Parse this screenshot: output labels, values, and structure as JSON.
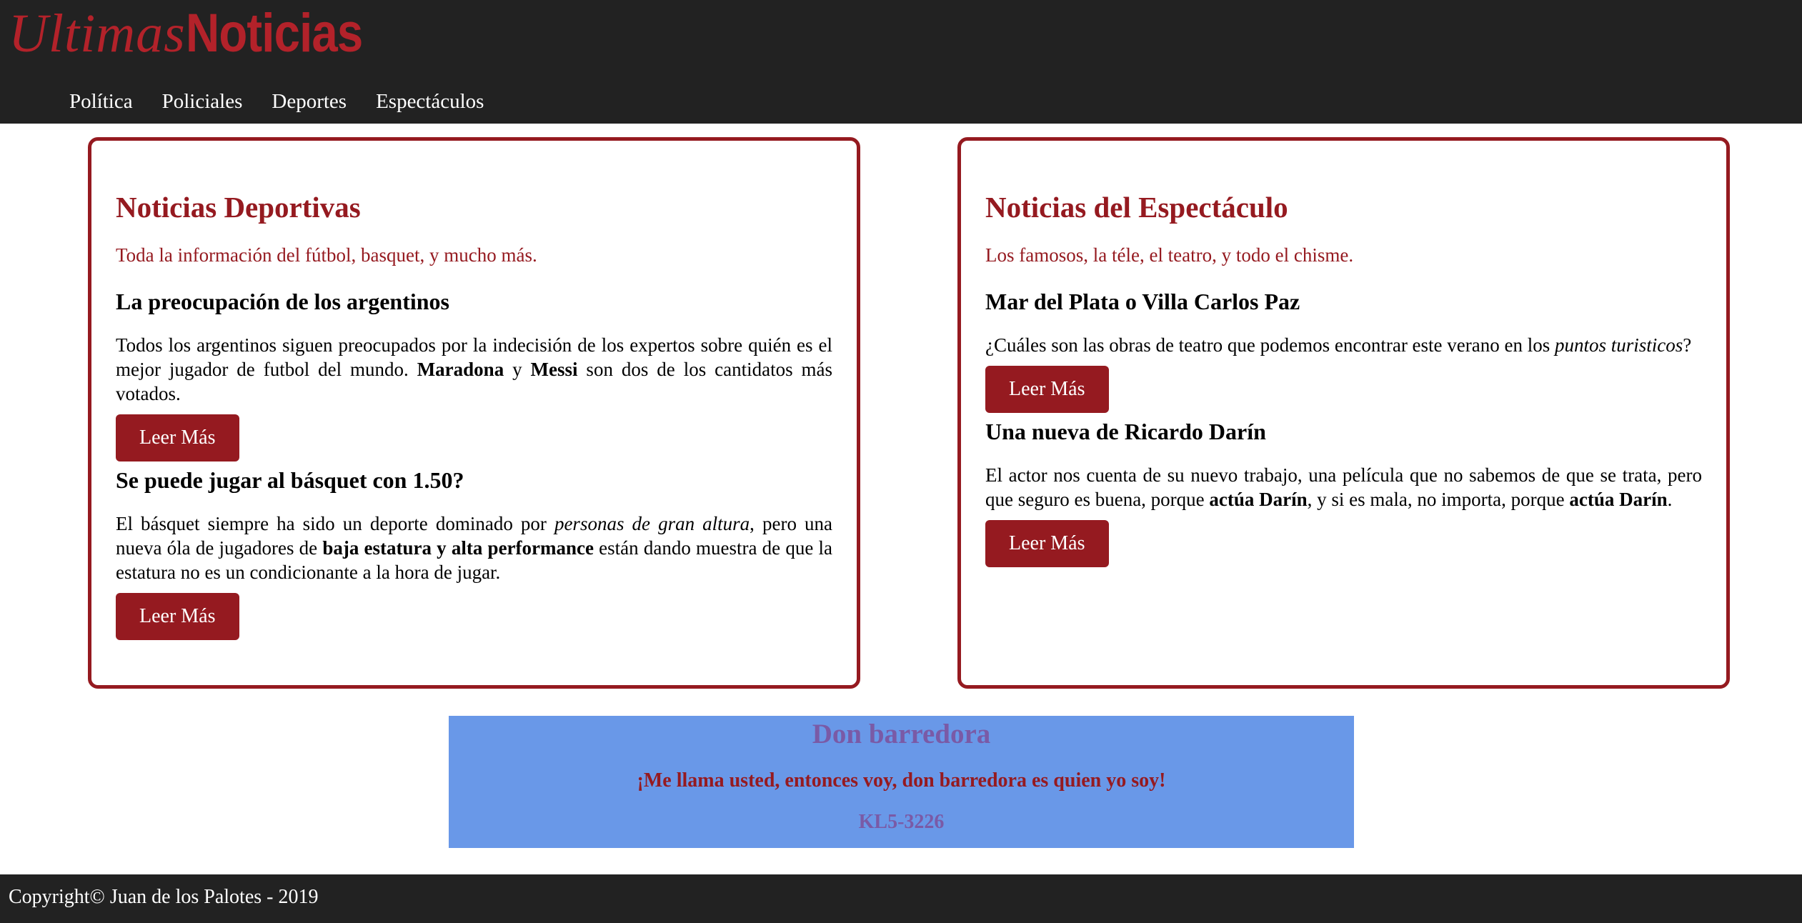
{
  "logo": {
    "script": "Ultimas",
    "bold": "Noticias"
  },
  "nav": [
    "Política",
    "Policiales",
    "Deportes",
    "Espectáculos"
  ],
  "sections": [
    {
      "title": "Noticias Deportivas",
      "subtitle": "Toda la información del fútbol, basquet, y mucho más.",
      "articles": [
        {
          "title": "La preocupación de los argentinos",
          "body": [
            {
              "t": "Todos los argentinos siguen preocupados por la indecisión de los expertos sobre quién es el mejor jugador de futbol del mundo. "
            },
            {
              "t": "Maradona",
              "b": true
            },
            {
              "t": " y "
            },
            {
              "t": "Messi",
              "b": true
            },
            {
              "t": " son dos de los cantidatos más votados."
            }
          ],
          "button": "Leer Más"
        },
        {
          "title": "Se puede jugar al básquet con 1.50?",
          "body": [
            {
              "t": "El básquet siempre ha sido un deporte dominado por "
            },
            {
              "t": "personas de gran altura",
              "i": true
            },
            {
              "t": ", pero una nueva óla de jugadores de "
            },
            {
              "t": "baja estatura y alta performance",
              "b": true
            },
            {
              "t": " están dando muestra de que la estatura no es un condicionante a la hora de jugar."
            }
          ],
          "button": "Leer Más"
        }
      ]
    },
    {
      "title": "Noticias del Espectáculo",
      "subtitle": "Los famosos, la téle, el teatro, y todo el chisme.",
      "articles": [
        {
          "title": "Mar del Plata o Villa Carlos Paz",
          "body": [
            {
              "t": "¿Cuáles son las obras de teatro que podemos encontrar este verano en los "
            },
            {
              "t": "puntos turisticos",
              "i": true
            },
            {
              "t": "?"
            }
          ],
          "button": "Leer Más"
        },
        {
          "title": "Una nueva de Ricardo Darín",
          "body": [
            {
              "t": "El actor nos cuenta de su nuevo trabajo, una película que no sabemos de que se trata, pero que seguro es buena, porque "
            },
            {
              "t": "actúa Darín",
              "b": true
            },
            {
              "t": ", y si es mala, no importa, porque "
            },
            {
              "t": "actúa Darín",
              "b": true
            },
            {
              "t": "."
            }
          ],
          "button": "Leer Más"
        }
      ]
    }
  ],
  "ad": {
    "title": "Don barredora",
    "slogan": "¡Me llama usted, entonces voy, don barredora es quien yo soy!",
    "phone": "KL5-3226"
  },
  "footer": "Copyright© Juan de los Palotes - 2019",
  "colors": {
    "accent": "#951a20",
    "dark": "#222222",
    "ad_bg": "#6998e8",
    "ad_text": "#7a5aa6"
  }
}
